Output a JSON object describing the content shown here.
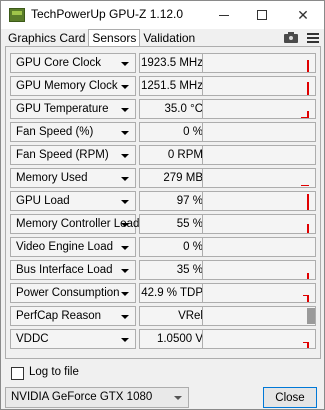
{
  "window": {
    "title": "TechPowerUp GPU-Z 1.12.0"
  },
  "tabs": [
    {
      "label": "Graphics Card",
      "active": false
    },
    {
      "label": "Sensors",
      "active": true
    },
    {
      "label": "Validation",
      "active": false
    }
  ],
  "toolbar_icons": [
    "camera-icon",
    "hamburger-menu-icon"
  ],
  "sensors": [
    {
      "name": "GPU Core Clock",
      "value": "1923.5 MHz"
    },
    {
      "name": "GPU Memory Clock",
      "value": "1251.5 MHz"
    },
    {
      "name": "GPU Temperature",
      "value": "35.0 °C"
    },
    {
      "name": "Fan Speed (%)",
      "value": "0 %"
    },
    {
      "name": "Fan Speed (RPM)",
      "value": "0 RPM"
    },
    {
      "name": "Memory Used",
      "value": "279 MB"
    },
    {
      "name": "GPU Load",
      "value": "97 %"
    },
    {
      "name": "Memory Controller Load",
      "value": "55 %"
    },
    {
      "name": "Video Engine Load",
      "value": "0 %"
    },
    {
      "name": "Bus Interface Load",
      "value": "35 %"
    },
    {
      "name": "Power Consumption",
      "value": "42.9 % TDP"
    },
    {
      "name": "PerfCap Reason",
      "value": "VRel"
    },
    {
      "name": "VDDC",
      "value": "1.0500 V"
    }
  ],
  "log_to_file": {
    "label": "Log to file",
    "checked": false
  },
  "gpu_select": {
    "selected": "NVIDIA GeForce GTX 1080"
  },
  "close_button": {
    "label": "Close"
  },
  "colors": {
    "graph_line": "#e00000",
    "perfcap_bar": "#9a9a9a",
    "focus_border": "#0078d7"
  }
}
